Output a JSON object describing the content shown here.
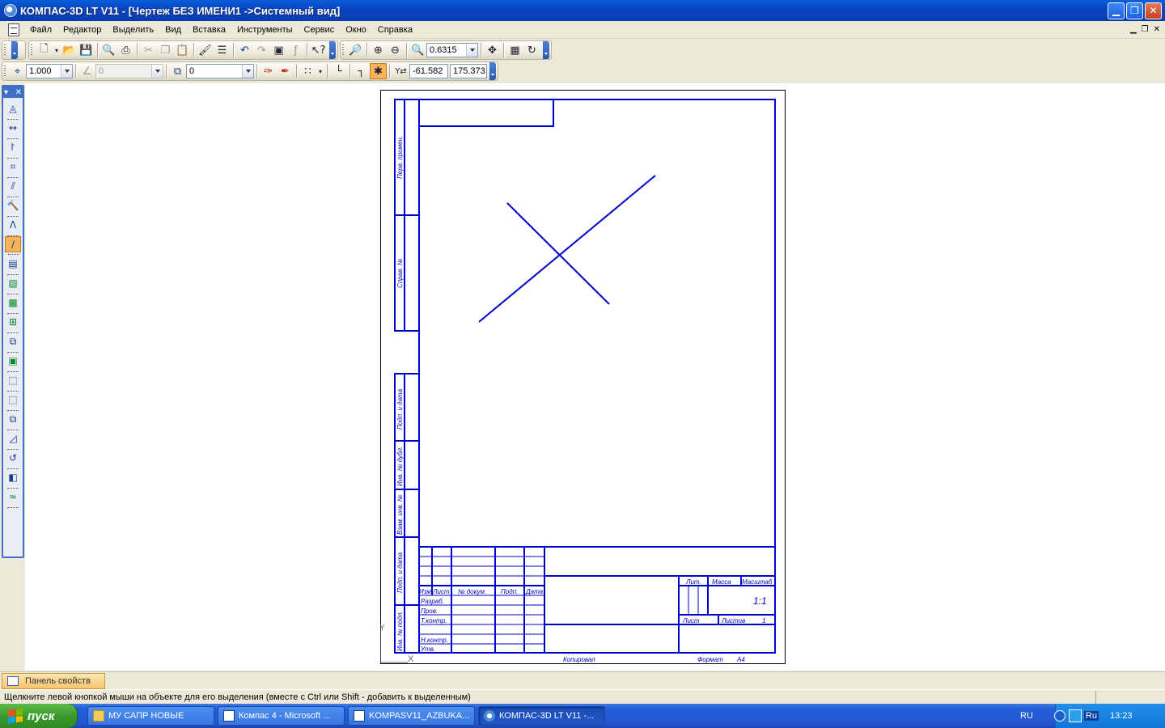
{
  "window": {
    "title": "КОМПАС-3D LT V11 - [Чертеж БЕЗ ИМЕНИ1 ->Системный вид]"
  },
  "menu": {
    "items": [
      "Файл",
      "Редактор",
      "Выделить",
      "Вид",
      "Вставка",
      "Инструменты",
      "Сервис",
      "Окно",
      "Справка"
    ]
  },
  "toolbar": {
    "zoom_value": "0.6315"
  },
  "current_state": {
    "step_value": "1.000",
    "angle_value": "0",
    "layer_value": "0",
    "coord_x": "-61.582",
    "coord_y": "175.373"
  },
  "drawing": {
    "title_block": {
      "col_izm": "Изм.",
      "col_list": "Лист",
      "col_ndoc": "№ докум.",
      "col_podp": "Подп.",
      "col_data": "Дата",
      "row_razrab": "Разраб.",
      "row_prov": "Пров.",
      "row_tkontr": "Т.контр.",
      "row_nkontr": "Н.контр.",
      "row_utv": "Утв.",
      "lit": "Лит.",
      "massa": "Масса",
      "masshtab": "Масштаб",
      "scale_value": "1:1",
      "list": "Лист",
      "listov": "Листов",
      "listov_value": "1",
      "kopiroval": "Копировал",
      "format": "Формат",
      "format_value": "A4"
    },
    "side_labels": {
      "perv_primen": "Перв. примен.",
      "sprav_n": "Справ. №",
      "podp_data_1": "Подп. и дата",
      "inv_dubl": "Инв. № дубл.",
      "vzam_inv": "Взам. инв. №",
      "podp_data_2": "Подп. и дата",
      "inv_podl": "Инв. № подл."
    },
    "axis_x": "X",
    "axis_y": "Y"
  },
  "properties_panel": {
    "tab_label": "Панель свойств"
  },
  "status": {
    "message": "Щелкните левой кнопкой мыши на объекте для его выделения (вместе с Ctrl или Shift - добавить к выделенным)"
  },
  "taskbar": {
    "start_label": "пуск",
    "tasks": [
      "МУ САПР НОВЫЕ",
      "Компас 4 - Microsoft ...",
      "KOMPASV11_AZBUKA...",
      "КОМПАС-3D LT V11 -..."
    ],
    "lang": "RU",
    "lang_indicator": "Ru",
    "clock": "13:23"
  },
  "colors": {
    "drawing_line": "#0000cc",
    "titlebar": "#0a46c4",
    "active_tool": "#f6b35a"
  }
}
